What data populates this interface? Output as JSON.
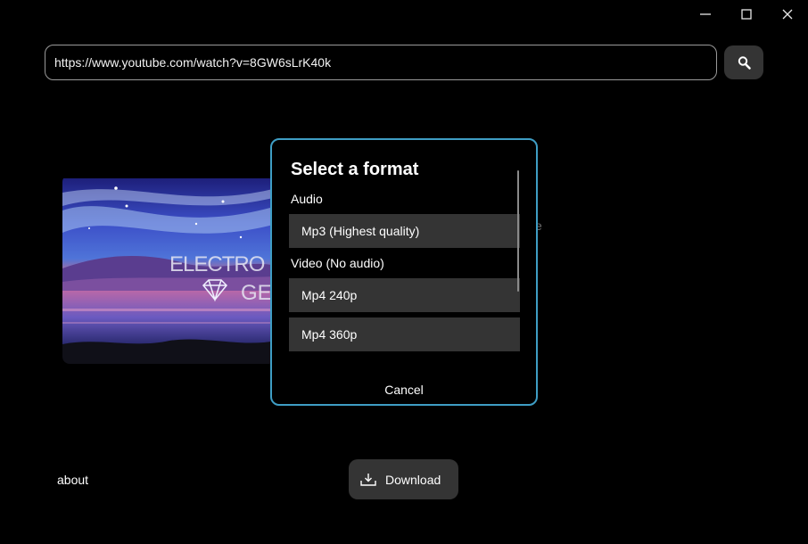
{
  "window": {
    "controls": [
      "minimize-icon",
      "maximize-icon",
      "close-icon"
    ]
  },
  "url_input": {
    "value": "https://www.youtube.com/watch?v=8GW6sLrK40k"
  },
  "search_button": {
    "icon": "search-icon"
  },
  "thumbnail": {
    "text_line1": "ELECTRO",
    "text_line2": "GE"
  },
  "behind_text": "e",
  "dialog": {
    "title": "Select a format",
    "audio_label": "Audio",
    "audio_options": [
      "Mp3 (Highest quality)"
    ],
    "video_label": "Video (No audio)",
    "video_options": [
      "Mp4 240p",
      "Mp4 360p"
    ],
    "cancel_label": "Cancel",
    "border_color": "#3e9dc4"
  },
  "footer": {
    "about_label": "about",
    "download_label": "Download",
    "download_icon": "download-icon"
  }
}
